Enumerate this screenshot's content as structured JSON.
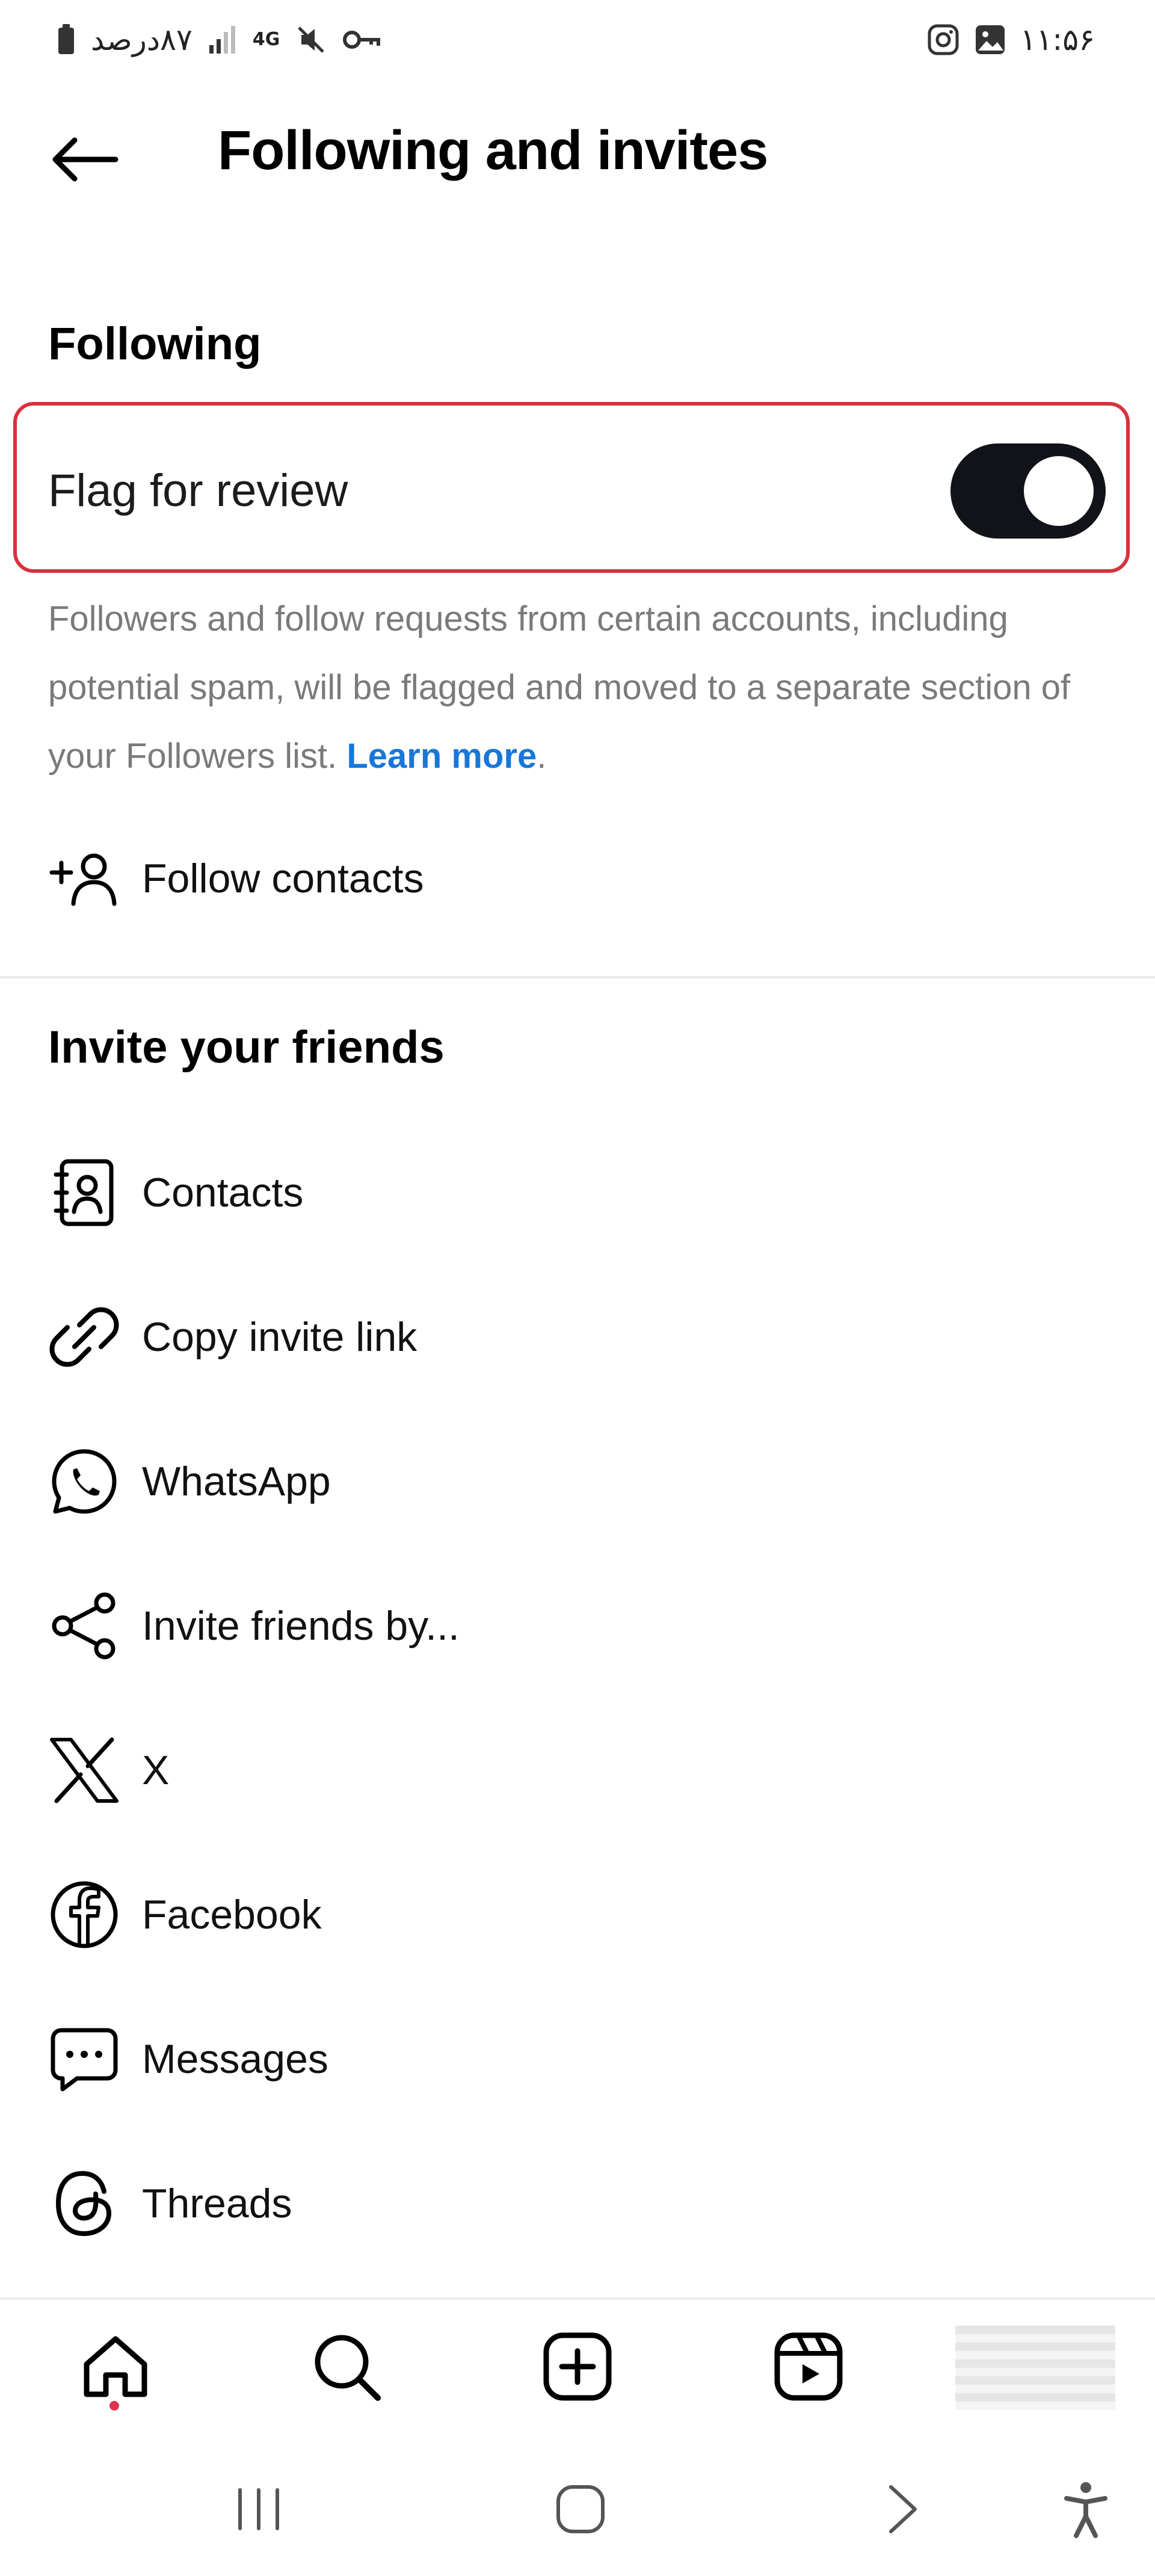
{
  "status_bar": {
    "battery_text": "۸۷درصد",
    "network": "4G",
    "time": "۱۱:۵۶"
  },
  "header": {
    "title": "Following and invites"
  },
  "following": {
    "section_title": "Following",
    "flag_label": "Flag for review",
    "flag_enabled": true,
    "description": "Followers and follow requests from certain accounts, including potential spam, will be flagged and moved to a separate section of your Followers list. ",
    "learn_more": "Learn more",
    "period": ".",
    "follow_contacts": "Follow contacts"
  },
  "invite": {
    "section_title": "Invite your friends",
    "items": [
      {
        "label": "Contacts",
        "icon": "contacts-icon"
      },
      {
        "label": "Copy invite link",
        "icon": "link-icon"
      },
      {
        "label": "WhatsApp",
        "icon": "whatsapp-icon"
      },
      {
        "label": "Invite friends by...",
        "icon": "share-icon"
      },
      {
        "label": "X",
        "icon": "x-icon"
      },
      {
        "label": "Facebook",
        "icon": "facebook-icon"
      },
      {
        "label": "Messages",
        "icon": "messages-icon"
      },
      {
        "label": "Threads",
        "icon": "threads-icon"
      }
    ]
  },
  "bottom_nav": [
    "home-icon",
    "search-icon",
    "create-icon",
    "reels-icon",
    "profile"
  ],
  "colors": {
    "accent_link": "#1877d8",
    "toggle_on": "#111318",
    "highlight_border": "#d8313e",
    "notification_dot": "#e0334c"
  }
}
